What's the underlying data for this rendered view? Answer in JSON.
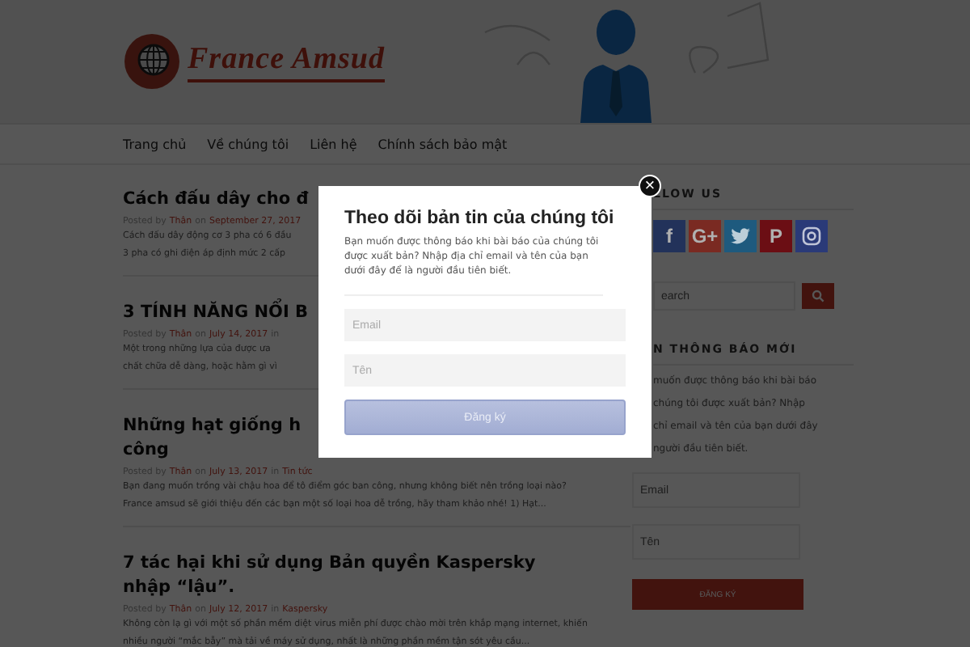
{
  "header": {
    "logo_text": "France Amsud"
  },
  "nav": [
    {
      "label": "Trang chủ"
    },
    {
      "label": "Về chúng tôi"
    },
    {
      "label": "Liên hệ"
    },
    {
      "label": "Chính sách bảo mật"
    }
  ],
  "posts": [
    {
      "title_lines": [
        "Cách đấu dây cho đ"
      ],
      "meta": [
        {
          "kind": "plain",
          "text": "Posted by"
        },
        {
          "kind": "link",
          "text": "Thân"
        },
        {
          "kind": "plain",
          "text": "on"
        },
        {
          "kind": "link",
          "text": "September 27, 2017"
        }
      ],
      "excerpt": [
        "Cách đấu dây động cơ 3 pha có 6 đầu",
        "3 pha có ghi điện áp định mức 2 cấp"
      ]
    },
    {
      "title_lines": [
        "3 TÍNH NĂNG NỔI B"
      ],
      "meta": [
        {
          "kind": "plain",
          "text": "Posted by"
        },
        {
          "kind": "link",
          "text": "Thân"
        },
        {
          "kind": "plain",
          "text": "on"
        },
        {
          "kind": "link",
          "text": "July 14, 2017"
        },
        {
          "kind": "plain",
          "text": "in"
        }
      ],
      "excerpt": [
        "Một trong những lựa của được ưa",
        "chất chữa dễ dàng, hoặc hằm gì vì"
      ]
    },
    {
      "title_lines": [
        "Những hạt giống h",
        "công"
      ],
      "meta": [
        {
          "kind": "plain",
          "text": "Posted by"
        },
        {
          "kind": "link",
          "text": "Thân"
        },
        {
          "kind": "plain",
          "text": "on"
        },
        {
          "kind": "link",
          "text": "July 13, 2017"
        },
        {
          "kind": "plain",
          "text": "in"
        },
        {
          "kind": "link",
          "text": "Tin tức"
        }
      ],
      "excerpt": [
        "Bạn đang muốn trồng vài chậu hoa để tô điểm góc ban công, nhưng không biết nên trồng loại nào?",
        "France amsud sẽ giới thiệu đến các bạn một số loại hoa dễ trồng, hãy tham khảo nhé! 1) Hạt..."
      ]
    },
    {
      "title_lines": [
        "7 tác hại khi sử dụng Bản quyền Kaspersky",
        "nhập “lậu”."
      ],
      "meta": [
        {
          "kind": "plain",
          "text": "Posted by"
        },
        {
          "kind": "link",
          "text": "Thân"
        },
        {
          "kind": "plain",
          "text": "on"
        },
        {
          "kind": "link",
          "text": "July 12, 2017"
        },
        {
          "kind": "plain",
          "text": "in"
        },
        {
          "kind": "link",
          "text": "Kaspersky"
        }
      ],
      "excerpt": [
        "Không còn lạ gì với một số phần mềm diệt virus miễn phí được chào mời trên khắp mạng internet, khiến",
        "nhiều người “mắc bẫy” mà tải về máy sử dụng, nhất là những phần mềm tận sót yêu cầu..."
      ]
    }
  ],
  "sidebar": {
    "follow_heading": "LLOW US",
    "social": [
      {
        "kind": "glyph",
        "glyph": "f",
        "color": "#22325a"
      },
      {
        "kind": "glyph",
        "glyph": "G+",
        "color": "#7a2a22"
      },
      {
        "kind": "bird",
        "color": "#1e5a7e"
      },
      {
        "kind": "glyph",
        "glyph": "P",
        "color": "#6b0e14"
      },
      {
        "kind": "camera",
        "color": "#2a3a78"
      }
    ],
    "search": {
      "placeholder": "earch"
    },
    "newsletter_heading": "N THÔNG BÁO MỚI",
    "newsletter_text": [
      "muốn được thông báo khi bài báo",
      "chúng tôi được xuất bản? Nhập",
      "chỉ email và tên của bạn dưới đây",
      "người đầu tiên biết."
    ],
    "email": {
      "placeholder": "Email"
    },
    "name": {
      "placeholder": "Tên"
    },
    "button": "ĐĂNG KÝ"
  },
  "modal": {
    "close": "×",
    "title": "Theo dõi bản tin của chúng tôi",
    "text": "Bạn muốn được thông báo khi bài báo của chúng tôi được xuất bản? Nhập địa chỉ email và tên của bạn dưới đây để là người đầu tiên biết.",
    "email": {
      "placeholder": "Email"
    },
    "name": {
      "placeholder": "Tên"
    },
    "button": "Đăng ký"
  }
}
